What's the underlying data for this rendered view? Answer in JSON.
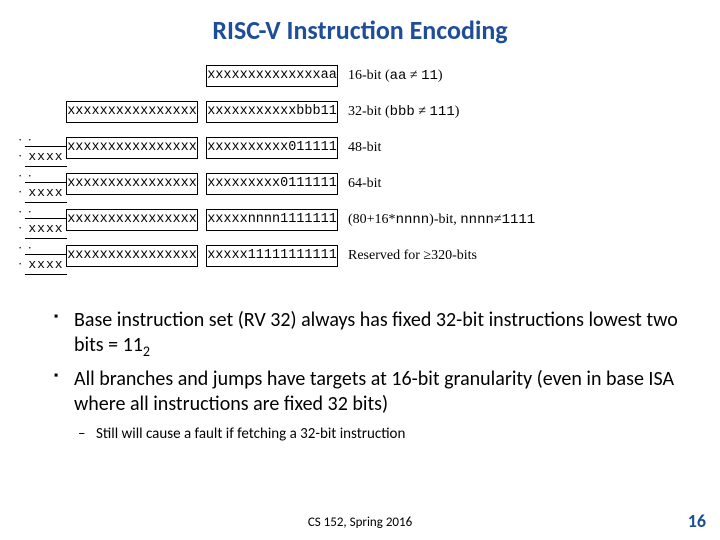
{
  "title": "RISC-V Instruction Encoding",
  "rows": {
    "r16": {
      "cell": "xxxxxxxxxxxxxxaa",
      "label_a": "16-bit (",
      "label_b": "aa",
      "label_c": " ≠ ",
      "label_d": "11",
      "label_e": ")"
    },
    "r32": {
      "cell_l": "xxxxxxxxxxxxxxxx",
      "cell_r": "xxxxxxxxxxxbbb11",
      "label_a": "32-bit (",
      "label_b": "bbb",
      "label_c": " ≠ ",
      "label_d": "111",
      "label_e": ")"
    },
    "r48": {
      "dots": "· · ·",
      "cell_n": "xxxx",
      "cell_l": "xxxxxxxxxxxxxxxx",
      "cell_r": "xxxxxxxxxx011111",
      "label": "48-bit"
    },
    "r64": {
      "dots": "· · ·",
      "cell_n": "xxxx",
      "cell_l": "xxxxxxxxxxxxxxxx",
      "cell_r": "xxxxxxxxx0111111",
      "label": "64-bit"
    },
    "r80": {
      "dots": "· · ·",
      "cell_n": "xxxx",
      "cell_l": "xxxxxxxxxxxxxxxx",
      "cell_r": "xxxxxnnnn1111111",
      "label_a": "(80+16*",
      "label_b": "nnnn",
      "label_c": ")-bit, ",
      "label_d": "nnnn",
      "label_e": "≠",
      "label_f": "1111"
    },
    "r320": {
      "dots": "· · ·",
      "cell_n": "xxxx",
      "cell_l": "xxxxxxxxxxxxxxxx",
      "cell_r": "xxxxx11111111111",
      "label": "Reserved for ≥320-bits"
    }
  },
  "bullets": {
    "b1a": "Base instruction set (RV 32) always has fixed 32-bit instructions lowest two bits = 11",
    "b1a_sub": "2",
    "b1b": "All branches and jumps have targets at 16-bit granularity (even in base ISA where all instructions are fixed 32 bits)",
    "b2": "Still will cause a fault if fetching a 32-bit instruction"
  },
  "footer": "CS 152, Spring 2016",
  "page": "16"
}
